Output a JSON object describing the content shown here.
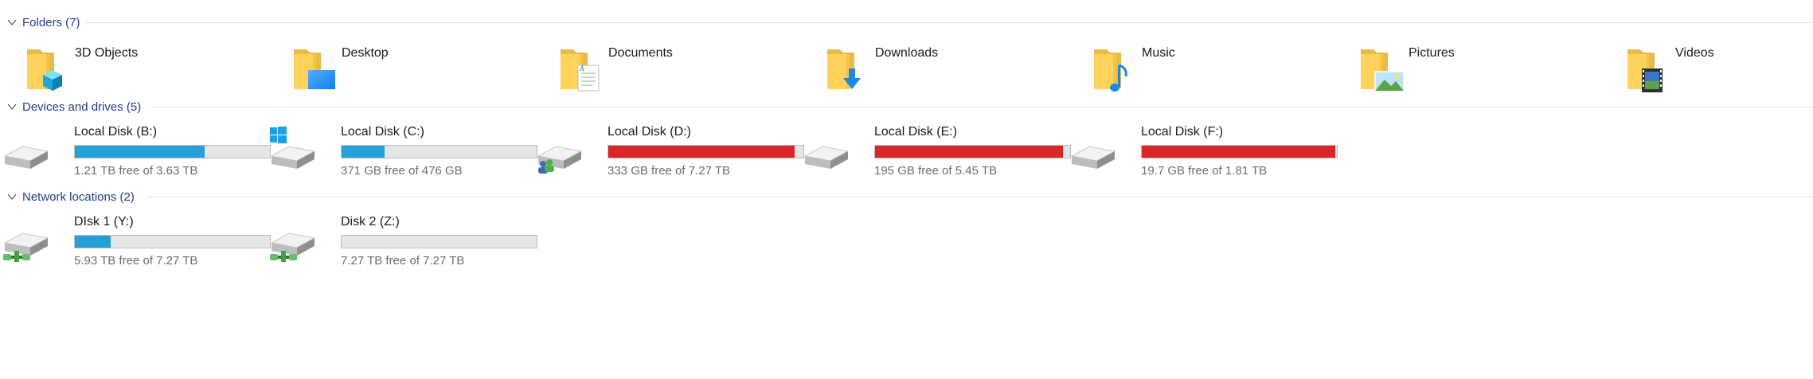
{
  "groups": {
    "folders": {
      "title": "Folders (7)"
    },
    "devices": {
      "title": "Devices and drives (5)"
    },
    "network": {
      "title": "Network locations (2)"
    }
  },
  "folders": [
    {
      "name": "3D Objects",
      "icon": "3d-objects-folder-icon"
    },
    {
      "name": "Desktop",
      "icon": "desktop-folder-icon"
    },
    {
      "name": "Documents",
      "icon": "documents-folder-icon"
    },
    {
      "name": "Downloads",
      "icon": "downloads-folder-icon"
    },
    {
      "name": "Music",
      "icon": "music-folder-icon"
    },
    {
      "name": "Pictures",
      "icon": "pictures-folder-icon"
    },
    {
      "name": "Videos",
      "icon": "videos-folder-icon"
    }
  ],
  "drives": [
    {
      "name": "Local Disk (B:)",
      "free": "1.21 TB free of 3.63 TB",
      "used_fraction": 0.667,
      "status": "normal",
      "icon": "hard-drive-icon"
    },
    {
      "name": "Local Disk (C:)",
      "free": "371 GB free of 476 GB",
      "used_fraction": 0.22,
      "status": "normal",
      "icon": "windows-drive-icon"
    },
    {
      "name": "Local Disk (D:)",
      "free": "333 GB free of 7.27 TB",
      "used_fraction": 0.955,
      "status": "full",
      "icon": "shared-drive-icon"
    },
    {
      "name": "Local Disk (E:)",
      "free": "195 GB free of 5.45 TB",
      "used_fraction": 0.965,
      "status": "full",
      "icon": "hard-drive-icon"
    },
    {
      "name": "Local Disk (F:)",
      "free": "19.7 GB free of 1.81 TB",
      "used_fraction": 0.99,
      "status": "full",
      "icon": "hard-drive-icon"
    }
  ],
  "network": [
    {
      "name": "DIsk 1 (Y:)",
      "free": "5.93 TB free of 7.27 TB",
      "used_fraction": 0.184,
      "status": "normal",
      "icon": "network-drive-icon"
    },
    {
      "name": "Disk 2 (Z:)",
      "free": "7.27 TB free of 7.27 TB",
      "used_fraction": 0.0,
      "status": "normal",
      "icon": "network-drive-icon"
    }
  ],
  "colors": {
    "header_text": "#1e3f8a",
    "bar_normal": "#26a0da",
    "bar_full": "#da2626",
    "bar_track": "#e6e6e6",
    "free_text": "#6d6d6d"
  }
}
